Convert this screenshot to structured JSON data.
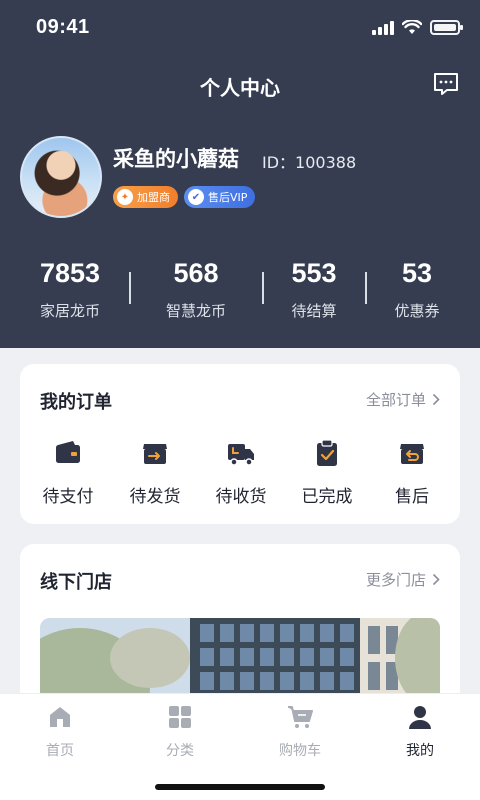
{
  "status_bar": {
    "time": "09:41"
  },
  "nav": {
    "title": "个人中心",
    "message_icon": "message-icon"
  },
  "profile": {
    "name": "采鱼的小蘑菇",
    "id_text": "ID：100388",
    "badges": [
      {
        "label": "加盟商",
        "icon": "franchise-icon",
        "color": "#f27e2b"
      },
      {
        "label": "售后VIP",
        "icon": "vip-icon",
        "color": "#3f6fe0"
      }
    ]
  },
  "stats": [
    {
      "value": "7853",
      "label": "家居龙币"
    },
    {
      "value": "568",
      "label": "智慧龙币"
    },
    {
      "value": "553",
      "label": "待结算"
    },
    {
      "value": "53",
      "label": "优惠券"
    }
  ],
  "orders": {
    "title": "我的订单",
    "more": "全部订单",
    "items": [
      {
        "label": "待支付",
        "icon": "wallet-icon"
      },
      {
        "label": "待发货",
        "icon": "box-arrow-icon"
      },
      {
        "label": "待收货",
        "icon": "truck-icon"
      },
      {
        "label": "已完成",
        "icon": "clipboard-check-icon"
      },
      {
        "label": "售后",
        "icon": "return-box-icon"
      }
    ]
  },
  "stores": {
    "title": "线下门店",
    "more": "更多门店"
  },
  "tabs": [
    {
      "label": "首页",
      "icon": "home-icon",
      "active": false
    },
    {
      "label": "分类",
      "icon": "grid-icon",
      "active": false
    },
    {
      "label": "购物车",
      "icon": "cart-icon",
      "active": false
    },
    {
      "label": "我的",
      "icon": "user-icon",
      "active": true
    }
  ],
  "colors": {
    "header_bg": "#363d50",
    "accent_dark": "#2f3547",
    "tab_inactive": "#a8acb4"
  }
}
